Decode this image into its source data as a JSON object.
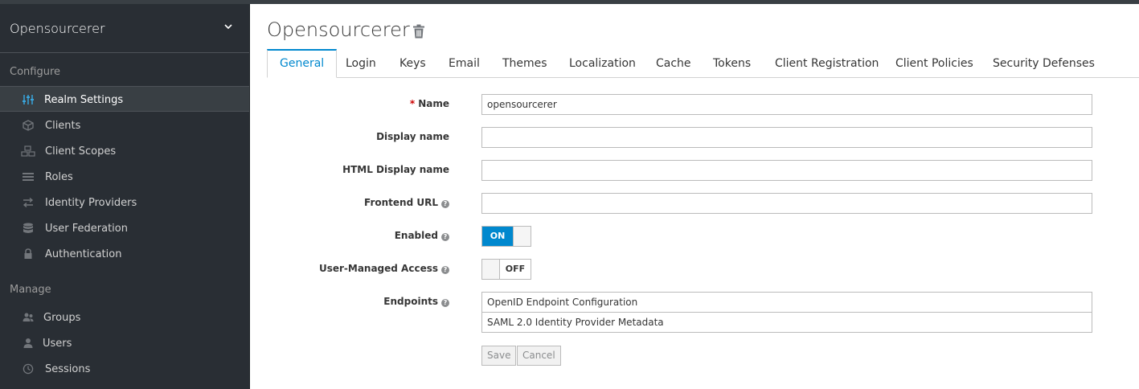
{
  "sidebar": {
    "realm_name": "Opensourcerer",
    "configure_label": "Configure",
    "manage_label": "Manage",
    "configure_items": [
      {
        "label": "Realm Settings",
        "icon": "sliders-icon",
        "active": true
      },
      {
        "label": "Clients",
        "icon": "cube-icon"
      },
      {
        "label": "Client Scopes",
        "icon": "cubes-icon"
      },
      {
        "label": "Roles",
        "icon": "list-icon"
      },
      {
        "label": "Identity Providers",
        "icon": "exchange-icon"
      },
      {
        "label": "User Federation",
        "icon": "database-icon"
      },
      {
        "label": "Authentication",
        "icon": "lock-icon"
      }
    ],
    "manage_items": [
      {
        "label": "Groups",
        "icon": "users-group-icon"
      },
      {
        "label": "Users",
        "icon": "user-icon"
      },
      {
        "label": "Sessions",
        "icon": "clock-icon"
      }
    ]
  },
  "header": {
    "title": "Opensourcerer"
  },
  "tabs": [
    {
      "label": "General",
      "active": true
    },
    {
      "label": "Login"
    },
    {
      "label": "Keys"
    },
    {
      "label": "Email"
    },
    {
      "label": "Themes"
    },
    {
      "label": "Localization"
    },
    {
      "label": "Cache"
    },
    {
      "label": "Tokens"
    },
    {
      "label": "Client Registration"
    },
    {
      "label": "Client Policies"
    },
    {
      "label": "Security Defenses"
    }
  ],
  "form": {
    "name_label": "Name",
    "name_required_mark": "*",
    "name_value": "opensourcerer",
    "display_name_label": "Display name",
    "display_name_value": "",
    "html_display_name_label": "HTML Display name",
    "html_display_name_value": "",
    "frontend_url_label": "Frontend URL",
    "frontend_url_value": "",
    "enabled_label": "Enabled",
    "enabled_state": "ON",
    "user_managed_access_label": "User-Managed Access",
    "user_managed_access_state": "OFF",
    "endpoints_label": "Endpoints",
    "endpoints": [
      "OpenID Endpoint Configuration",
      "SAML 2.0 Identity Provider Metadata"
    ],
    "help_glyph": "?",
    "save_label": "Save",
    "cancel_label": "Cancel"
  },
  "colors": {
    "sidebar_bg": "#292e34",
    "accent": "#0088ce",
    "required": "#cc0000"
  }
}
